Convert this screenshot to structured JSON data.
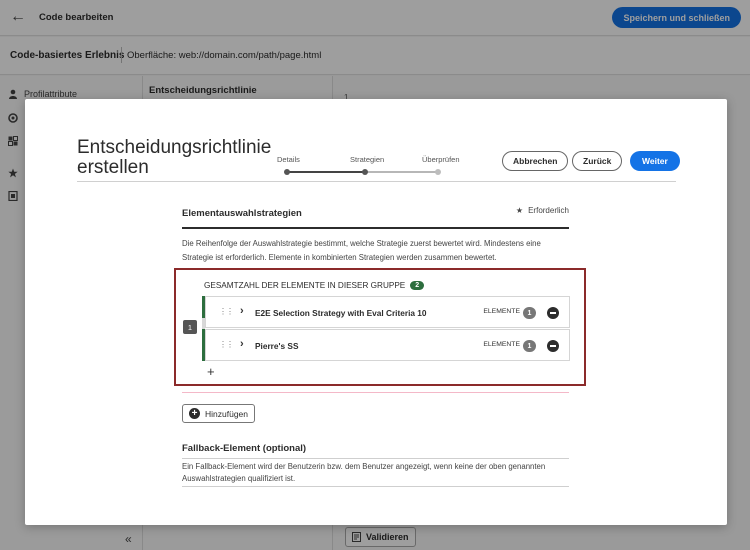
{
  "app": {
    "header_title": "Code bearbeiten",
    "save_close_label": "Speichern und schließen",
    "experience_title": "Code-basiertes Erlebnis",
    "surface_label": "Oberfläche: web://domain.com/path/page.html"
  },
  "left_rail": {
    "items": [
      {
        "label": "Profilattribute",
        "icon": "person-icon"
      }
    ]
  },
  "middle_pane": {
    "title": "Entscheidungsrichtlinie"
  },
  "editor": {
    "line_number": "1",
    "validate_label": "Validieren"
  },
  "modal": {
    "title": "Entscheidungsrichtlinie erstellen",
    "steps": [
      {
        "label": "Details",
        "state": "done"
      },
      {
        "label": "Strategien",
        "state": "current"
      },
      {
        "label": "Überprüfen",
        "state": "future"
      }
    ],
    "cancel_label": "Abbrechen",
    "back_label": "Zurück",
    "next_label": "Weiter",
    "section": {
      "title": "Elementauswahlstrategien",
      "required_label": "Erforderlich",
      "description": "Die Reihenfolge der Auswahlstrategie bestimmt, welche Strategie zuerst bewertet wird. Mindestens eine Strategie ist erforderlich. Elemente in kombinierten Strategien werden zusammen bewertet."
    },
    "group": {
      "header": "GESAMTZAHL DER ELEMENTE IN DIESER GRUPPE",
      "count": "2",
      "order": "1",
      "strategies": [
        {
          "name": "E2E Selection Strategy with Eval Criteria 10",
          "elements_label": "ELEMENTE",
          "count": "1"
        },
        {
          "name": "Pierre's SS",
          "elements_label": "ELEMENTE",
          "count": "1"
        }
      ]
    },
    "add_label": "Hinzufügen",
    "fallback": {
      "title": "Fallback-Element (optional)",
      "description": "Ein Fallback-Element wird der Benutzerin bzw. dem Benutzer angezeigt, wenn keine der oben genannten Auswahlstrategien qualifiziert ist."
    }
  },
  "colors": {
    "accent": "#1473e6",
    "group_green": "#2d6e3e",
    "highlight_border": "#8b2a2a"
  }
}
